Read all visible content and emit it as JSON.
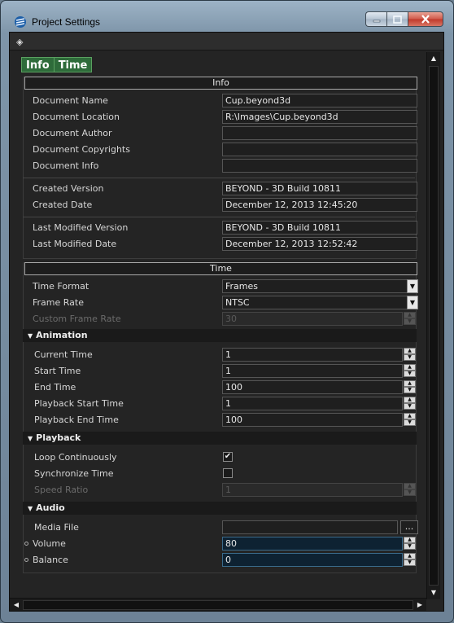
{
  "window": {
    "title": "Project Settings",
    "app_icon": "beyond3d-logo-icon",
    "minimize_icon": "minimize-icon",
    "maximize_icon": "maximize-icon",
    "close_icon": "close-icon",
    "close_color": "#c8453a"
  },
  "toolbar": {
    "pin_icon": "diamond-pin-icon",
    "pin_glyph": "◈"
  },
  "tabs": [
    {
      "label": "Info"
    },
    {
      "label": "Time"
    }
  ],
  "accent_color": "#2e6b3a",
  "info": {
    "header": "Info",
    "document_name": {
      "label": "Document Name",
      "value": "Cup.beyond3d"
    },
    "document_location": {
      "label": "Document Location",
      "value": "R:\\Images\\Cup.beyond3d"
    },
    "document_author": {
      "label": "Document Author",
      "value": ""
    },
    "document_copyrights": {
      "label": "Document Copyrights",
      "value": ""
    },
    "document_info": {
      "label": "Document Info",
      "value": ""
    },
    "created_version": {
      "label": "Created Version",
      "value": "BEYOND - 3D Build 10811"
    },
    "created_date": {
      "label": "Created Date",
      "value": "December 12, 2013 12:45:20"
    },
    "last_modified_version": {
      "label": "Last Modified Version",
      "value": "BEYOND - 3D Build 10811"
    },
    "last_modified_date": {
      "label": "Last Modified Date",
      "value": "December 12, 2013 12:52:42"
    }
  },
  "time": {
    "header": "Time",
    "time_format": {
      "label": "Time Format",
      "value": "Frames"
    },
    "frame_rate": {
      "label": "Frame Rate",
      "value": "NTSC"
    },
    "custom_frame_rate": {
      "label": "Custom Frame Rate",
      "value": "30",
      "disabled": true
    },
    "animation": {
      "label": "Animation",
      "current_time": {
        "label": "Current Time",
        "value": "1"
      },
      "start_time": {
        "label": "Start Time",
        "value": "1"
      },
      "end_time": {
        "label": "End Time",
        "value": "100"
      },
      "playback_start_time": {
        "label": "Playback Start Time",
        "value": "1"
      },
      "playback_end_time": {
        "label": "Playback End Time",
        "value": "100"
      }
    },
    "playback": {
      "label": "Playback",
      "loop_continuously": {
        "label": "Loop Continuously",
        "checked": true,
        "glyph": "✔"
      },
      "synchronize_time": {
        "label": "Synchronize Time",
        "checked": false
      },
      "speed_ratio": {
        "label": "Speed Ratio",
        "value": "1",
        "disabled": true
      }
    },
    "audio": {
      "label": "Audio",
      "media_file": {
        "label": "Media File",
        "value": "",
        "browse_label": "..."
      },
      "volume": {
        "label": "Volume",
        "value": "80"
      },
      "balance": {
        "label": "Balance",
        "value": "0"
      }
    }
  }
}
